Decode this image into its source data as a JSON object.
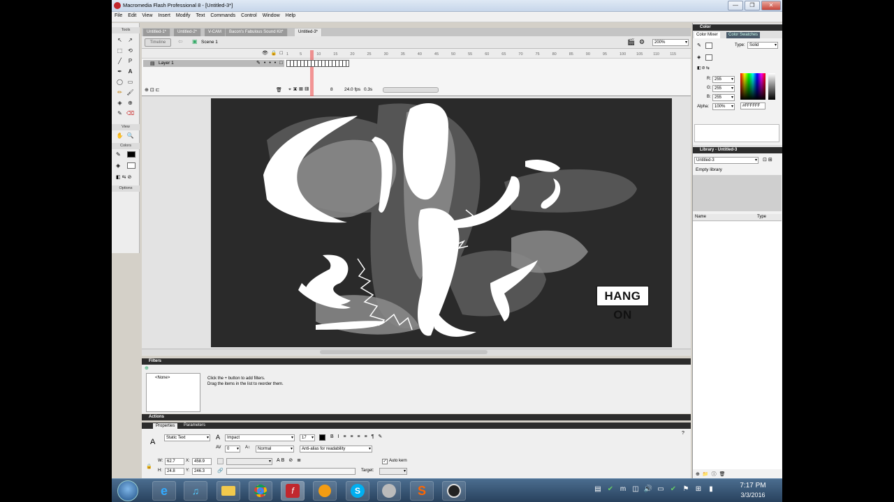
{
  "window": {
    "title": "Macromedia Flash Professional 8 - [Untitled-3*]",
    "min": "—",
    "max": "❐",
    "close": "✕"
  },
  "menu": [
    "File",
    "Edit",
    "View",
    "Insert",
    "Modify",
    "Text",
    "Commands",
    "Control",
    "Window",
    "Help"
  ],
  "tools": {
    "header": "Tools",
    "view_label": "View",
    "colors_label": "Colors",
    "options_label": "Options",
    "icons": [
      "↖",
      "↗",
      "⬚",
      "⟲",
      "╱",
      "P",
      "✒",
      "A",
      "◯",
      "▭",
      "✏",
      "🖌",
      "◈",
      "⊕",
      "✎",
      "⌫",
      "✋",
      "🔍"
    ]
  },
  "doc_tabs": [
    "Untitled-1*",
    "Untitled-2*",
    "V-CAM",
    "Bacon's Fabulous Sound Kit*",
    "Untitled-3*"
  ],
  "edit_bar": {
    "timeline_btn": "Timeline",
    "scene": "Scene 1",
    "zoom": "200%"
  },
  "timeline": {
    "layer_name": "Layer 1",
    "frame_numbers": [
      "1",
      "5",
      "10",
      "15",
      "20",
      "25",
      "30",
      "35",
      "40",
      "45",
      "50",
      "55",
      "60",
      "65",
      "70",
      "75",
      "80",
      "85",
      "90",
      "95",
      "100",
      "105",
      "110",
      "115"
    ],
    "current_frame": "8",
    "fps": "24.0 fps",
    "time": "0.3s"
  },
  "stage": {
    "label": "HANG ON"
  },
  "filters": {
    "title": "Filters",
    "list_item": "<None>",
    "help1": "Click the + button to add filters.",
    "help2": "Drag the items in the list to reorder them."
  },
  "actions": {
    "title": "Actions"
  },
  "properties": {
    "tab_props": "Properties",
    "tab_params": "Parameters",
    "text_type": "Static Text",
    "font": "Impact",
    "size": "17",
    "spacing": "0",
    "position": "Normal",
    "antialias": "Anti-alias for readability",
    "w": "62.7",
    "x": "458.9",
    "h": "24.8",
    "y": "246.3",
    "w_label": "W:",
    "x_label": "X:",
    "h_label": "H:",
    "y_label": "Y:",
    "autokern": "Auto kern",
    "target_label": "Target:"
  },
  "color_panel": {
    "title": "Color",
    "tab_mixer": "Color Mixer",
    "tab_swatches": "Color Swatches",
    "type_label": "Type:",
    "type_value": "Solid",
    "r_label": "R:",
    "g_label": "G:",
    "b_label": "B:",
    "r": "255",
    "g": "255",
    "b": "255",
    "alpha_label": "Alpha:",
    "alpha": "100%",
    "hex": "#FFFFFF"
  },
  "library": {
    "title": "Library - Untitled-3",
    "dropdown": "Untitled-3",
    "empty": "Empty library",
    "col_name": "Name",
    "col_type": "Type"
  },
  "clock": {
    "time": "7:17 PM",
    "date": "3/3/2016"
  }
}
